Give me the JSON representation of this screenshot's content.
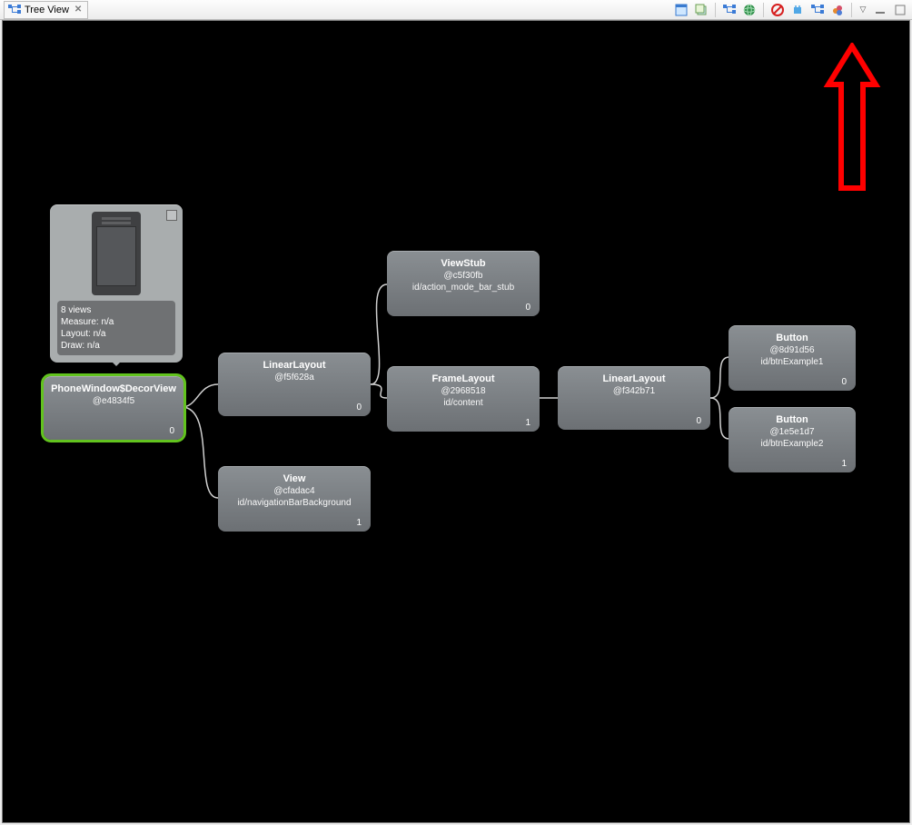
{
  "tab": {
    "title": "Tree View"
  },
  "toolbar_icons": [
    "window-restore-icon",
    "layers-icon",
    "sep",
    "tree-icon",
    "globe-icon",
    "sep",
    "forbidden-icon",
    "android-icon",
    "tree-icon",
    "profile-cpu-icon",
    "sep",
    "menu-chevron-icon",
    "minimize-icon",
    "maximize-icon"
  ],
  "callout": {
    "views_label": "8 views",
    "measure": "Measure: n/a",
    "layout": "Layout: n/a",
    "draw": "Draw: n/a"
  },
  "nodes": {
    "root": {
      "title": "PhoneWindow$DecorView",
      "hash": "@e4834f5",
      "id": "",
      "count": "0"
    },
    "lin1": {
      "title": "LinearLayout",
      "hash": "@f5f628a",
      "id": "",
      "count": "0"
    },
    "view": {
      "title": "View",
      "hash": "@cfadac4",
      "id": "id/navigationBarBackground",
      "count": "1"
    },
    "stub": {
      "title": "ViewStub",
      "hash": "@c5f30fb",
      "id": "id/action_mode_bar_stub",
      "count": "0"
    },
    "frame": {
      "title": "FrameLayout",
      "hash": "@2968518",
      "id": "id/content",
      "count": "1"
    },
    "lin2": {
      "title": "LinearLayout",
      "hash": "@f342b71",
      "id": "",
      "count": "0"
    },
    "btn1": {
      "title": "Button",
      "hash": "@8d91d56",
      "id": "id/btnExample1",
      "count": "0"
    },
    "btn2": {
      "title": "Button",
      "hash": "@1e5e1d7",
      "id": "id/btnExample2",
      "count": "1"
    }
  }
}
